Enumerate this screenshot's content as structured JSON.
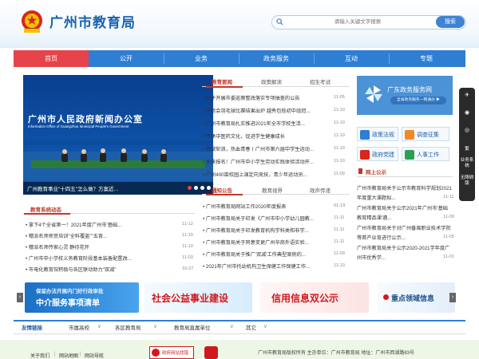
{
  "header": {
    "site_title": "广州市教育局",
    "search_placeholder": "请输入关键文字搜索",
    "search_button": "搜索"
  },
  "nav": [
    "首页",
    "公开",
    "业务",
    "政务服务",
    "互动",
    "专题"
  ],
  "banner": {
    "sign_cn": "广州市人民政府新闻办公室",
    "sign_en": "Information Office of Guangzhou Municipal People's Government",
    "caption": "广州教育事业\"十四五\"怎么做？方案近..."
  },
  "news_top": {
    "tabs": [
      "教育要闻",
      "政策解读",
      "招生考试"
    ],
    "items": [
      {
        "title": "关于开展市委巡察整改落实专项抽查的公告",
        "date": "11-05"
      },
      {
        "title": "中运会羽毛球比赛结果出炉 越秀包揽初中组冠...",
        "date": "11-10"
      },
      {
        "title": "广州市教育局扎实推进2021年全市学校生活...",
        "date": "11-10"
      },
      {
        "title": "传承中医药文化，促进学生健康成长",
        "date": "11-10"
      },
      {
        "title": "劈波斩浪，热血青春丨广州市第六届中学生运动...",
        "date": "11-10"
      },
      {
        "title": "快来报名！广州市中小学生劳动实践体验活动开...",
        "date": "11-10"
      },
      {
        "title": "广州400亩校园上演定向竞技，青少年运动员...",
        "date": "11-09"
      }
    ]
  },
  "notices": {
    "tabs": [
      "通知公告",
      "教育视界",
      "政声传递"
    ],
    "items": [
      {
        "title": "广州市教育局网站工作2020年度报表",
        "date": "01-19"
      },
      {
        "title": "广州市教育局关于印发《广州市中小学幼儿园教...",
        "date": "11-11"
      },
      {
        "title": "广州市教育局关于印发教育机构学科类和非学...",
        "date": "11-11"
      },
      {
        "title": "广州市教育局关于同意变更广州华商外语实验...",
        "date": "11-11"
      },
      {
        "title": "广州市教育局关于推广'双减'工作典型案例的...",
        "date": "11-09"
      },
      {
        "title": "2021年广州市托幼机构卫生保健工作保健工作...",
        "date": "11-10"
      }
    ]
  },
  "system_news": {
    "title": "教育系统动态",
    "items": [
      {
        "title": "拿下4个全省第一！2021年度广州市'基础...",
        "date": "11-12"
      },
      {
        "title": "穗派名师师资培训\"全科覆盖\"\"五育...",
        "date": "11-10"
      },
      {
        "title": "穗派名师传家心灵 静待花开",
        "date": "11-10"
      },
      {
        "title": "广州市中小学校义务教育阶段基本装备配置改...",
        "date": "11-03"
      },
      {
        "title": "市电化教育馆积极与各区联动助力\"双减\"",
        "date": "10-27"
      }
    ]
  },
  "service": {
    "title": "广东政务服务网",
    "subtitle": "全省政务服务一网通办 ▶",
    "links": [
      "政策法规",
      "调查征集",
      "政府党建",
      "人事工作"
    ]
  },
  "online_publicity": {
    "title": "网上公示",
    "items": [
      {
        "title": "广州市教育局关于公示市教育科学规划2021年度重大课题拟...",
        "date": "11-11"
      },
      {
        "title": "广州市教育局关于公示2021年广州市'基础教育精品课'遴...",
        "date": "11-09"
      },
      {
        "title": "广州市教育局关于对广州番禺职业技术学院等首产业育进行公示...",
        "date": "11-05"
      },
      {
        "title": "广州市教育局关于公示2020-2021学年度广州市优秀学...",
        "date": "11-01"
      }
    ]
  },
  "promos": [
    {
      "line1": "保留办法开展内门好行政审批",
      "line2": "中介服务事项清单"
    },
    {
      "line1": "社会公益事业建设",
      "line2": ""
    },
    {
      "line1": "信用信息双公示",
      "line2": ""
    },
    {
      "line1": "重点领域信息",
      "line2": ""
    }
  ],
  "floating": {
    "item1": "繁",
    "item2": "业务系统",
    "item3": "无障碍版"
  },
  "links_bar": {
    "title": "友情链接",
    "items": [
      "市属高校",
      "各区教育局",
      "教育局直属单位",
      "其它"
    ]
  },
  "footer": {
    "links": [
      "关于我们",
      "网站地图",
      "网站导航"
    ],
    "badge1": "政府网站找错",
    "copyright": "广州市教育局版权所有 主办单位：广州市教育局 地址：广州市西湖路83号"
  },
  "colors": {
    "brand_blue": "#2e7ed4",
    "active_red": "#e7434a",
    "tab_red": "#c0392b"
  }
}
